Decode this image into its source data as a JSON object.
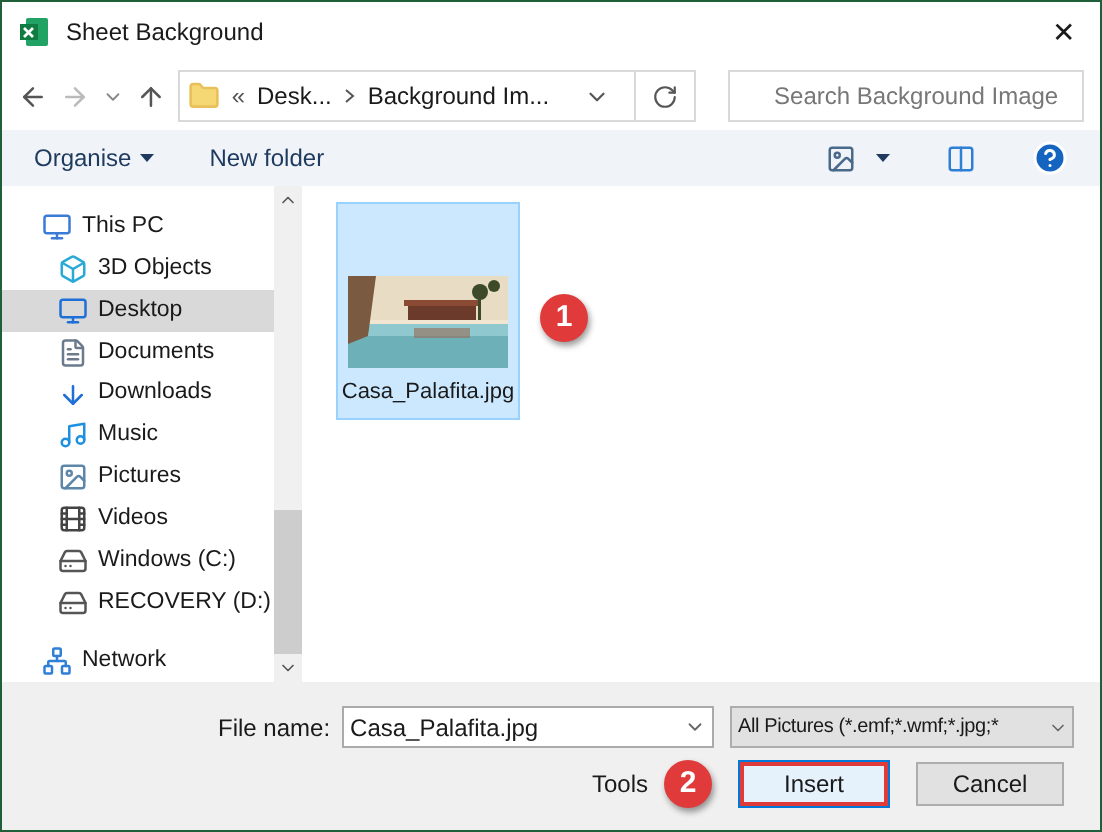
{
  "window": {
    "title": "Sheet Background",
    "close": "✕"
  },
  "nav": {
    "breadcrumb_prefix": "«",
    "path": [
      {
        "label": "Desk..."
      },
      {
        "label": "Background Im..."
      }
    ],
    "search": {
      "placeholder": "Search Background Image"
    }
  },
  "toolbar": {
    "organise": "Organise",
    "new_folder": "New folder"
  },
  "sidebar": {
    "items": [
      {
        "label": "This PC",
        "selected": false,
        "children": [
          {
            "label": "3D Objects",
            "selected": false
          },
          {
            "label": "Desktop",
            "selected": true
          },
          {
            "label": "Documents",
            "selected": false
          },
          {
            "label": "Downloads",
            "selected": false
          },
          {
            "label": "Music",
            "selected": false
          },
          {
            "label": "Pictures",
            "selected": false
          },
          {
            "label": "Videos",
            "selected": false
          },
          {
            "label": "Windows (C:)",
            "selected": false
          },
          {
            "label": "RECOVERY (D:)",
            "selected": false
          }
        ]
      },
      {
        "label": "Network",
        "selected": false
      }
    ]
  },
  "files": [
    {
      "name": "Casa_Palafita.jpg",
      "selected": true,
      "callout": "1"
    }
  ],
  "footer": {
    "file_name_label": "File name:",
    "file_name": "Casa_Palafita.jpg",
    "filter": "All Pictures (*.emf;*.wmf;*.jpg;*",
    "tools": "Tools",
    "callout": "2",
    "buttons": [
      {
        "label": "Insert",
        "highlighted": true
      },
      {
        "label": "Cancel",
        "highlighted": false
      }
    ]
  }
}
